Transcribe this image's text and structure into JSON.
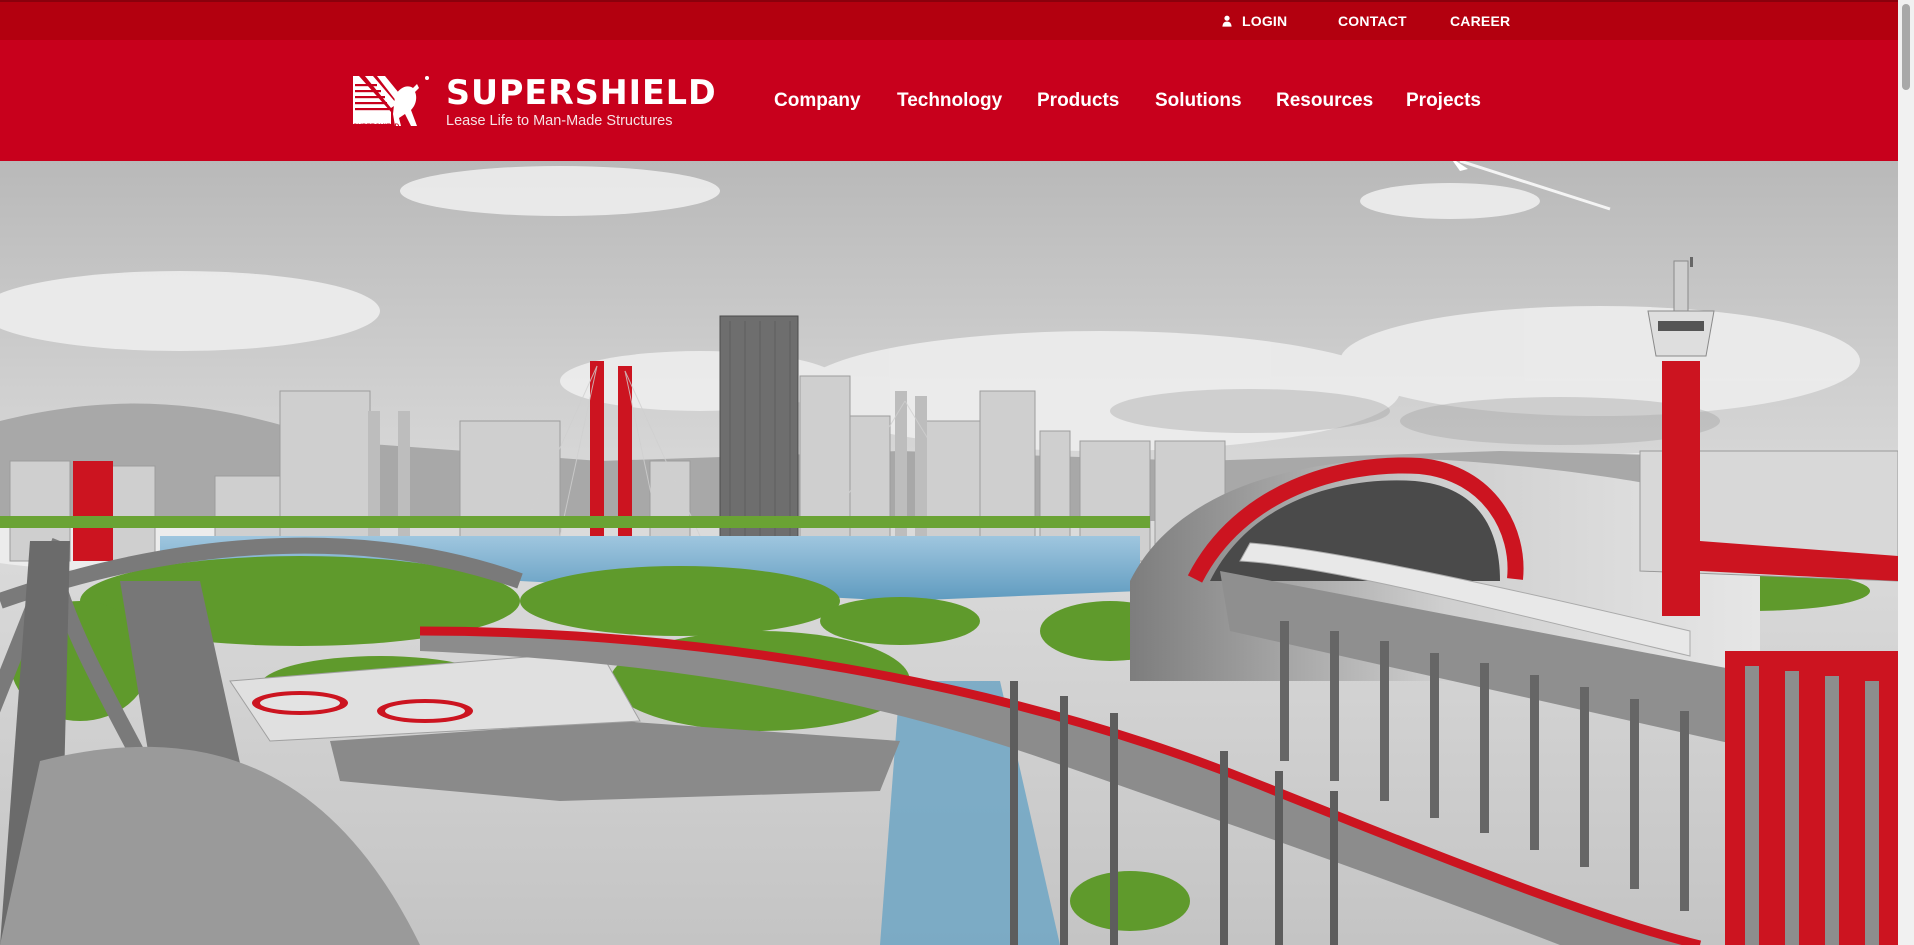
{
  "utility_nav": {
    "login": "LOGIN",
    "contact": "CONTACT",
    "career": "CAREER"
  },
  "brand": {
    "name": "SUPERSHIELD",
    "tagline": "Lease Life to Man-Made Structures",
    "icon_caption": "SUPERSHIELD"
  },
  "main_nav": [
    "Company",
    "Technology",
    "Products",
    "Solutions",
    "Resources",
    "Projects"
  ],
  "colors": {
    "topbar": "#b3000f",
    "nav": "#c8001c",
    "accent_red": "#cc1420",
    "text": "#ffffff"
  },
  "icons": {
    "login": "user-icon",
    "brand": "logo-mark-icon"
  }
}
